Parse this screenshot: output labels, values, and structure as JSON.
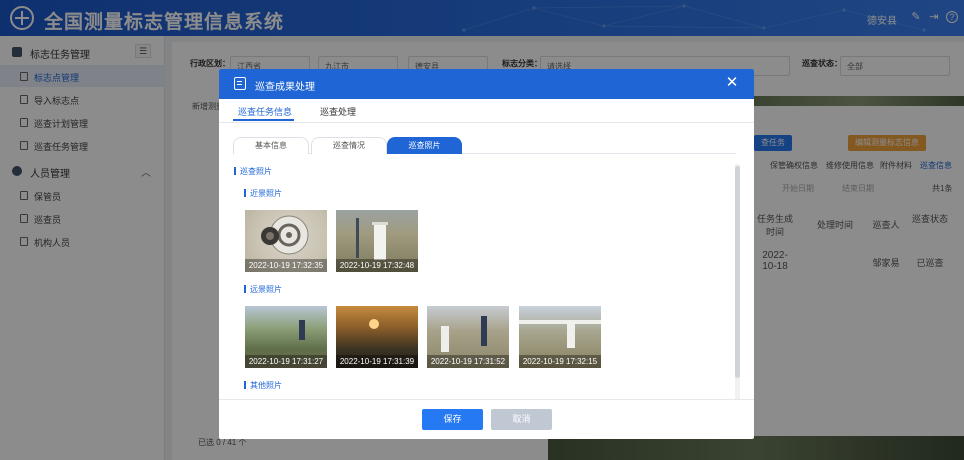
{
  "header": {
    "app_title": "全国测量标志管理信息系统",
    "user_name": "德安县"
  },
  "sidebar": {
    "groups": [
      {
        "label": "标志任务管理",
        "items": [
          "标志点管理",
          "导入标志点",
          "巡查计划管理",
          "巡查任务管理"
        ]
      },
      {
        "label": "人员管理",
        "items": [
          "保管员",
          "巡查员",
          "机构人员"
        ]
      }
    ],
    "active_item": "标志点管理"
  },
  "background": {
    "filters": {
      "region_label": "行政区划：",
      "province": "江西省",
      "city": "九江市",
      "county": "德安县",
      "mark_type_label": "标志分类：",
      "mark_type_placeholder": "请选择",
      "status_label": "巡查状态：",
      "status_value": "全部"
    },
    "new_button": "新增测量",
    "task_button": "查任务",
    "edit_button": "编辑测量标志信息",
    "tabs": [
      "保管确权信息",
      "维修使用信息",
      "附件材料",
      "巡查信息"
    ],
    "start_date": "开始日期",
    "end_date": "结束日期",
    "total": "共1条",
    "col_task_time": "任务生成时间",
    "col_handle_time": "处理时间",
    "col_inspector": "巡查人",
    "col_status": "巡查状态",
    "row_date": "2022-10-18",
    "row_inspector": "邹家易",
    "row_status": "已巡查",
    "selected_count": "已选 0 / 41 个"
  },
  "modal": {
    "title": "巡查成果处理",
    "tabs": [
      "巡查任务信息",
      "巡查处理"
    ],
    "subtabs": [
      "基本信息",
      "巡查情况",
      "巡查照片"
    ],
    "section_title": "巡查照片",
    "near_label": "近景照片",
    "far_label": "远景照片",
    "other_label": "其他照片",
    "near_photos": [
      "2022-10-19 17:32:35",
      "2022-10-19 17:32:48"
    ],
    "far_photos": [
      "2022-10-19 17:31:27",
      "2022-10-19 17:31:39",
      "2022-10-19 17:31:52",
      "2022-10-19 17:32:15"
    ],
    "save_label": "保存",
    "cancel_label": "取消"
  },
  "colors": {
    "primary": "#1f65d6",
    "button_blue": "#2579f2",
    "cancel_gray": "#c0c8d4",
    "orange": "#f0a03c"
  }
}
